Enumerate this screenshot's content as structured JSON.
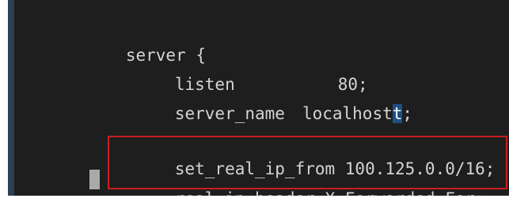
{
  "editor": {
    "lines": [
      "server {",
      "listen",
      "80;",
      "server_name",
      "localhost",
      ";",
      "set_real_ip_from 100.125.0.0/16;",
      "real_ip_header X-Forwarded-For;"
    ],
    "cursor_char": "t",
    "colors": {
      "background": "#1e1e1e",
      "text": "#d4d4d4",
      "highlight_border": "#c81e1e",
      "cursor_bg": "#1f4f86",
      "left_bar": "#2f3e55"
    }
  }
}
